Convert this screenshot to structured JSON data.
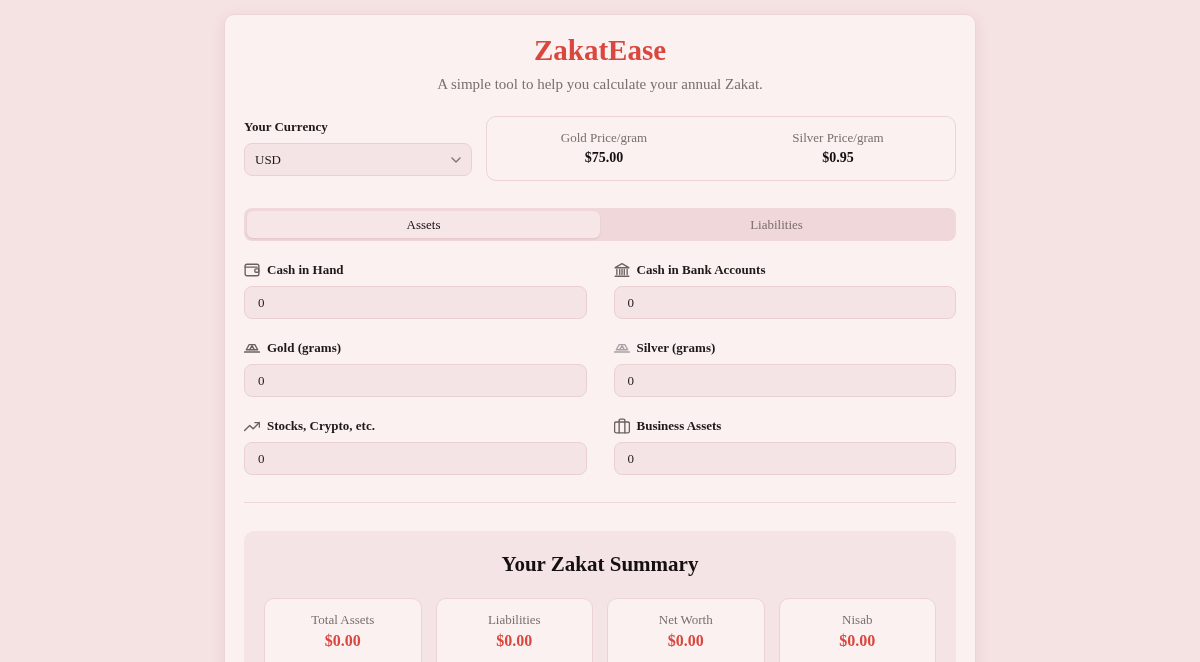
{
  "header": {
    "title": "ZakatEase",
    "subtitle": "A simple tool to help you calculate your annual Zakat."
  },
  "currency": {
    "label": "Your Currency",
    "value": "USD"
  },
  "prices": [
    {
      "label": "Gold Price/gram",
      "value": "$75.00"
    },
    {
      "label": "Silver Price/gram",
      "value": "$0.95"
    }
  ],
  "tabs": [
    {
      "label": "Assets",
      "selected": true
    },
    {
      "label": "Liabilities",
      "selected": false
    }
  ],
  "fields": [
    {
      "label": "Cash in Hand",
      "value": "0"
    },
    {
      "label": "Cash in Bank Accounts",
      "value": "0"
    },
    {
      "label": "Gold (grams)",
      "value": "0"
    },
    {
      "label": "Silver (grams)",
      "value": "0"
    },
    {
      "label": "Stocks, Crypto, etc.",
      "value": "0"
    },
    {
      "label": "Business Assets",
      "value": "0"
    }
  ],
  "summary": {
    "title": "Your Zakat Summary",
    "stats": [
      {
        "label": "Total Assets",
        "value": "$0.00"
      },
      {
        "label": "Liabilities",
        "value": "$0.00"
      },
      {
        "label": "Net Worth",
        "value": "$0.00"
      },
      {
        "label": "Nisab",
        "value": "$0.00"
      }
    ]
  }
}
